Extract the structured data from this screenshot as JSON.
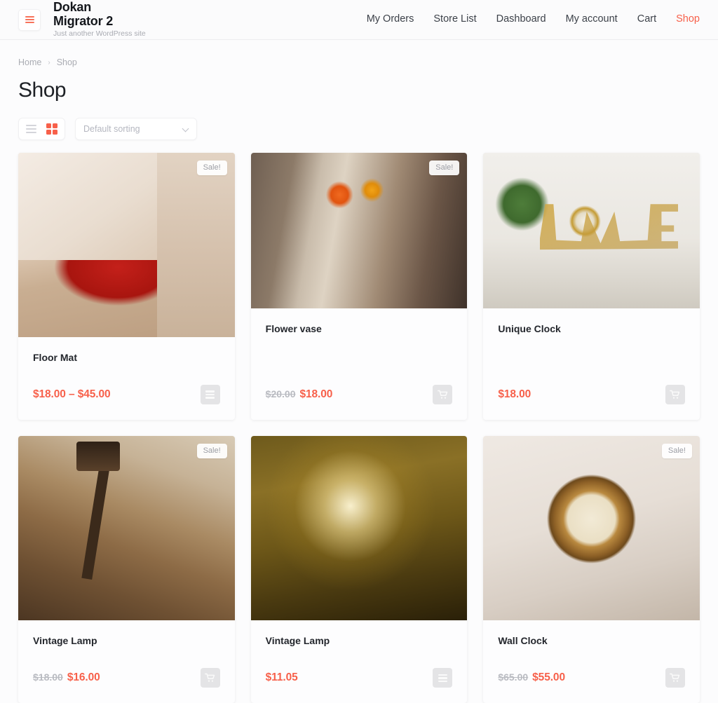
{
  "header": {
    "menu_toggle_name": "hamburger-icon",
    "brand_title": "Dokan Migrator 2",
    "brand_tagline": "Just another WordPress site",
    "nav": [
      {
        "label": "My Orders",
        "active": false
      },
      {
        "label": "Store List",
        "active": false
      },
      {
        "label": "Dashboard",
        "active": false
      },
      {
        "label": "My account",
        "active": false
      },
      {
        "label": "Cart",
        "active": false
      },
      {
        "label": "Shop",
        "active": true
      }
    ]
  },
  "breadcrumb": {
    "home": "Home",
    "separator": "›",
    "current": "Shop"
  },
  "page": {
    "title": "Shop"
  },
  "toolbar": {
    "list_view_label": "List view",
    "grid_view_label": "Grid view",
    "active_view": "grid",
    "sorting_value": "Default sorting"
  },
  "colors": {
    "accent": "#f7604a",
    "price": "#f7604a",
    "price_old": "#b9bbc1",
    "page_bg": "#fcfcfd",
    "card_bg": "#fdfdfe",
    "nav_text": "#3c4149",
    "muted": "#aaacb3"
  },
  "products": [
    {
      "name": "Floor Mat",
      "on_sale": true,
      "sale_label": "Sale!",
      "price_old": "",
      "price": "$18.00 – $45.00",
      "action": "select-options",
      "action_label": "Select options",
      "image_class": "img-floor-mat",
      "media_size": "tall"
    },
    {
      "name": "Flower vase",
      "on_sale": true,
      "sale_label": "Sale!",
      "price_old": "$20.00",
      "price": "$18.00",
      "action": "add-to-cart",
      "action_label": "Add to cart",
      "image_class": "img-flower-vase",
      "media_size": "short"
    },
    {
      "name": "Unique Clock",
      "on_sale": false,
      "sale_label": "",
      "price_old": "",
      "price": "$18.00",
      "action": "add-to-cart",
      "action_label": "Add to cart",
      "image_class": "img-unique-clock",
      "media_size": "short"
    },
    {
      "name": "Vintage Lamp",
      "on_sale": true,
      "sale_label": "Sale!",
      "price_old": "$18.00",
      "price": "$16.00",
      "action": "add-to-cart",
      "action_label": "Add to cart",
      "image_class": "img-vintage-lamp-1",
      "media_size": "tall"
    },
    {
      "name": "Vintage Lamp",
      "on_sale": false,
      "sale_label": "",
      "price_old": "",
      "price": "$11.05",
      "action": "select-options",
      "action_label": "Select options",
      "image_class": "img-vintage-lamp-2",
      "media_size": "tall"
    },
    {
      "name": "Wall Clock",
      "on_sale": true,
      "sale_label": "Sale!",
      "price_old": "$65.00",
      "price": "$55.00",
      "action": "add-to-cart",
      "action_label": "Add to cart",
      "image_class": "img-wall-clock",
      "media_size": "tall"
    }
  ]
}
